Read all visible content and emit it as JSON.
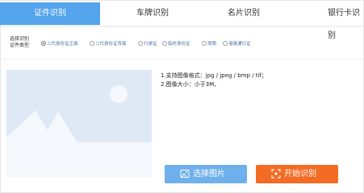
{
  "tabs": [
    {
      "label": "证件识别",
      "active": true
    },
    {
      "label": "车牌识别",
      "active": false
    },
    {
      "label": "名片识别",
      "active": false
    },
    {
      "label": "银行卡识别",
      "active": false
    }
  ],
  "id_type": {
    "label_line1": "选择识别",
    "label_line2": "证件类型",
    "options": [
      {
        "label": "二代身份证正面",
        "selected": true
      },
      {
        "label": "二代身份证背面",
        "selected": false
      },
      {
        "label": "行驶证",
        "selected": false
      },
      {
        "label": "临时身份证",
        "selected": false
      },
      {
        "label": "驾照",
        "selected": false
      },
      {
        "label": "港澳通行证",
        "selected": false
      }
    ]
  },
  "requirements": [
    "1.支持图像格式：jpg / jpeg / bmp / tif；",
    "2.图像大小：小于3M。"
  ],
  "buttons": {
    "select_image": "选择图片",
    "start_recognition": "开始识别"
  },
  "colors": {
    "tab_active": "#53a4ec",
    "select_button": "#6fb0ec",
    "start_button": "#f46b23",
    "placeholder_bg": "#dfe8f5",
    "placeholder_shape": "#f5f8fc"
  },
  "icons": {
    "select": "image-icon",
    "start": "scan-icon",
    "preview": "image-placeholder-icon"
  }
}
